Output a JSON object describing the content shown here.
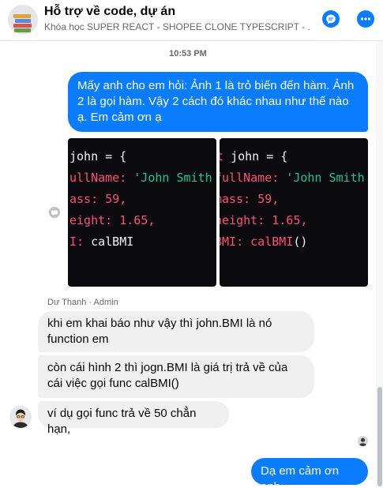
{
  "header": {
    "title": "Hỗ trợ về code, dự án",
    "subtitle": "Khóa học SUPER REACT - SHOPEE CLONE TYPESCRIPT - ...",
    "chat_icon": "chat-bubble-icon",
    "more_icon": "more-dots-icon"
  },
  "timestamp": "10:53 PM",
  "messages": {
    "question": "Mấy anh cho em hỏi: Ảnh 1 là trỏ biến đến hàm. Ảnh 2 là gọi hàm. Vậy 2 cách đó khác nhau như thế nào ạ. Em cảm ơn ạ",
    "sender": "Dư Thanh · Admin",
    "reply1": "khi em khai báo như vậy thì john.BMI là nó function em",
    "reply2": "còn cái hình 2 thì jogn.BMI là giá trị trả về của cái việc gọi func calBMI()",
    "reply3": "ví dụ gọi func trả về 50 chẳn hạn,",
    "thanks": "Dạ em cảm ơn anh"
  },
  "code_image_1": {
    "line1": "john = {",
    "line2_key": "ullName:",
    "line2_val": "'John Smith",
    "line3_key": "ass:",
    "line3_val": "59,",
    "line4_key": "eight:",
    "line4_val": "1.65,",
    "line5_key": "I:",
    "line5_val": "calBMI"
  },
  "code_image_2": {
    "line1_prefix": "t",
    "line1": "john = {",
    "line2_key": "fullName:",
    "line2_val": "'John Smith",
    "line3_key": "mass:",
    "line3_val": "59,",
    "line4_key": "height:",
    "line4_val": "1.65,",
    "line5_key": "BMI:",
    "line5_val": "calBMI",
    "line5_parens": "()"
  },
  "colors": {
    "accent": "#0a7cff",
    "incoming_bubble": "#f0f0f0",
    "code_bg": "#0b0b0f",
    "code_key": "#ff4f7b",
    "code_string": "#19c98f"
  }
}
